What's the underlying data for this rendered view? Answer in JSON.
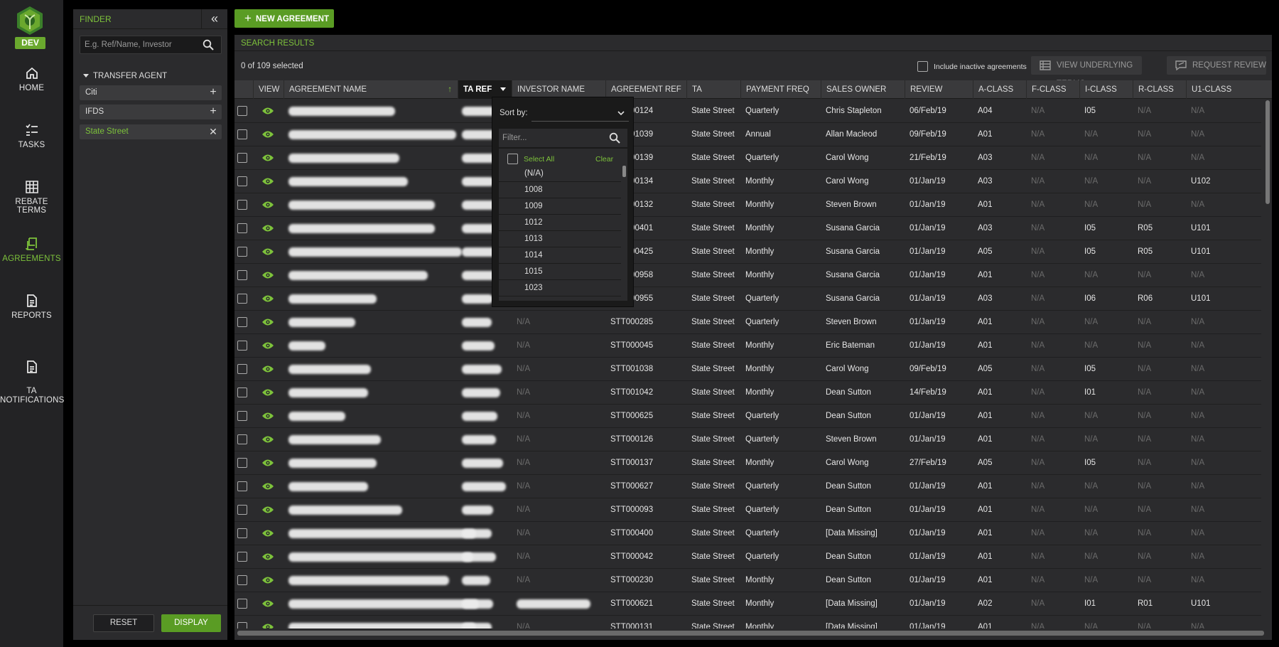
{
  "nav": {
    "env": "DEV",
    "items": [
      {
        "label": "HOME",
        "icon": "home-icon"
      },
      {
        "label": "TASKS",
        "icon": "tasks-icon"
      },
      {
        "label": "REBATE TERMS",
        "icon": "grid-icon"
      },
      {
        "label": "AGREEMENTS",
        "icon": "document-icon",
        "active": true
      },
      {
        "label": "REPORTS",
        "icon": "report-icon"
      },
      {
        "label": "TA\nNOTIFICATIONS",
        "icon": "notification-doc-icon"
      }
    ]
  },
  "finder": {
    "title": "FINDER",
    "collapse_icon": "«",
    "search_placeholder": "E.g. Ref/Name, Investor",
    "group_label": "TRANSFER AGENT",
    "filters": [
      {
        "label": "Citi",
        "selected": false
      },
      {
        "label": "IFDS",
        "selected": false
      },
      {
        "label": "State Street",
        "selected": true
      }
    ],
    "reset_label": "RESET",
    "display_label": "DISPLAY"
  },
  "new_agreement_label": "NEW AGREEMENT",
  "results": {
    "title": "SEARCH RESULTS",
    "selected_text": "0 of 109 selected",
    "include_inactive_label": "Include inactive agreements",
    "view_underlying_label": "VIEW UNDERLYING TERMS",
    "request_review_label": "REQUEST REVIEW",
    "columns": [
      "VIEW",
      "AGREEMENT NAME",
      "TA REF",
      "INVESTOR NAME",
      "AGREEMENT REF",
      "TA",
      "PAYMENT FREQ",
      "SALES OWNER",
      "REVIEW",
      "A-CLASS",
      "F-CLASS",
      "I-CLASS",
      "R-CLASS",
      "U1-CLASS"
    ],
    "rows": [
      {
        "investor": "",
        "ref": "STT000124",
        "ta": "State Street",
        "freq": "Quarterly",
        "owner": "Chris Stapleton",
        "review": "06/Feb/19",
        "a": "A04",
        "f": "N/A",
        "i": "I05",
        "r": "N/A",
        "u1": "N/A"
      },
      {
        "investor": "",
        "ref": "STT001039",
        "ta": "State Street",
        "freq": "Annual",
        "owner": "Allan Macleod",
        "review": "09/Feb/19",
        "a": "A01",
        "f": "N/A",
        "i": "N/A",
        "r": "N/A",
        "u1": "N/A"
      },
      {
        "investor": "",
        "ref": "STT000139",
        "ta": "State Street",
        "freq": "Quarterly",
        "owner": "Carol Wong",
        "review": "21/Feb/19",
        "a": "A03",
        "f": "N/A",
        "i": "N/A",
        "r": "N/A",
        "u1": "N/A"
      },
      {
        "investor": "",
        "ref": "STT000134",
        "ta": "State Street",
        "freq": "Monthly",
        "owner": "Carol Wong",
        "review": "01/Jan/19",
        "a": "A03",
        "f": "N/A",
        "i": "N/A",
        "r": "N/A",
        "u1": "U102"
      },
      {
        "investor": "",
        "ref": "STT000132",
        "ta": "State Street",
        "freq": "Monthly",
        "owner": "Steven Brown",
        "review": "01/Jan/19",
        "a": "A01",
        "f": "N/A",
        "i": "N/A",
        "r": "N/A",
        "u1": "N/A"
      },
      {
        "investor": "",
        "ref": "STT000401",
        "ta": "State Street",
        "freq": "Monthly",
        "owner": "Susana Garcia",
        "review": "01/Jan/19",
        "a": "A03",
        "f": "N/A",
        "i": "I05",
        "r": "R05",
        "u1": "U101"
      },
      {
        "investor": "",
        "ref": "STT000425",
        "ta": "State Street",
        "freq": "Monthly",
        "owner": "Susana Garcia",
        "review": "01/Jan/19",
        "a": "A05",
        "f": "N/A",
        "i": "I05",
        "r": "R05",
        "u1": "U101"
      },
      {
        "investor": "",
        "ref": "STT000958",
        "ta": "State Street",
        "freq": "Monthly",
        "owner": "Susana Garcia",
        "review": "01/Jan/19",
        "a": "A01",
        "f": "N/A",
        "i": "N/A",
        "r": "N/A",
        "u1": "N/A"
      },
      {
        "investor": "",
        "ref": "STT000955",
        "ta": "State Street",
        "freq": "Quarterly",
        "owner": "Susana Garcia",
        "review": "01/Jan/19",
        "a": "A03",
        "f": "N/A",
        "i": "I06",
        "r": "R06",
        "u1": "U101"
      },
      {
        "investor": "N/A",
        "ref": "STT000285",
        "ta": "State Street",
        "freq": "Quarterly",
        "owner": "Steven Brown",
        "review": "01/Jan/19",
        "a": "A01",
        "f": "N/A",
        "i": "N/A",
        "r": "N/A",
        "u1": "N/A"
      },
      {
        "investor": "N/A",
        "ref": "STT000045",
        "ta": "State Street",
        "freq": "Monthly",
        "owner": "Eric Bateman",
        "review": "01/Jan/19",
        "a": "A01",
        "f": "N/A",
        "i": "N/A",
        "r": "N/A",
        "u1": "N/A"
      },
      {
        "investor": "N/A",
        "ref": "STT001038",
        "ta": "State Street",
        "freq": "Monthly",
        "owner": "Carol Wong",
        "review": "09/Feb/19",
        "a": "A05",
        "f": "N/A",
        "i": "I05",
        "r": "N/A",
        "u1": "N/A"
      },
      {
        "investor": "N/A",
        "ref": "STT001042",
        "ta": "State Street",
        "freq": "Monthly",
        "owner": "Dean Sutton",
        "review": "14/Feb/19",
        "a": "A01",
        "f": "N/A",
        "i": "I01",
        "r": "N/A",
        "u1": "N/A"
      },
      {
        "investor": "N/A",
        "ref": "STT000625",
        "ta": "State Street",
        "freq": "Quarterly",
        "owner": "Dean Sutton",
        "review": "01/Jan/19",
        "a": "A01",
        "f": "N/A",
        "i": "N/A",
        "r": "N/A",
        "u1": "N/A"
      },
      {
        "investor": "N/A",
        "ref": "STT000126",
        "ta": "State Street",
        "freq": "Quarterly",
        "owner": "Steven Brown",
        "review": "01/Jan/19",
        "a": "A01",
        "f": "N/A",
        "i": "N/A",
        "r": "N/A",
        "u1": "N/A"
      },
      {
        "investor": "N/A",
        "ref": "STT000137",
        "ta": "State Street",
        "freq": "Monthly",
        "owner": "Carol Wong",
        "review": "27/Feb/19",
        "a": "A05",
        "f": "N/A",
        "i": "I05",
        "r": "N/A",
        "u1": "N/A"
      },
      {
        "investor": "N/A",
        "ref": "STT000627",
        "ta": "State Street",
        "freq": "Quarterly",
        "owner": "Dean Sutton",
        "review": "01/Jan/19",
        "a": "A01",
        "f": "N/A",
        "i": "N/A",
        "r": "N/A",
        "u1": "N/A"
      },
      {
        "investor": "N/A",
        "ref": "STT000093",
        "ta": "State Street",
        "freq": "Quarterly",
        "owner": "Dean Sutton",
        "review": "01/Jan/19",
        "a": "A01",
        "f": "N/A",
        "i": "N/A",
        "r": "N/A",
        "u1": "N/A"
      },
      {
        "investor": "N/A",
        "ref": "STT000400",
        "ta": "State Street",
        "freq": "Quarterly",
        "owner": "[Data Missing]",
        "review": "01/Jan/19",
        "a": "A01",
        "f": "N/A",
        "i": "N/A",
        "r": "N/A",
        "u1": "N/A"
      },
      {
        "investor": "N/A",
        "ref": "STT000042",
        "ta": "State Street",
        "freq": "Quarterly",
        "owner": "Dean Sutton",
        "review": "01/Jan/19",
        "a": "A01",
        "f": "N/A",
        "i": "N/A",
        "r": "N/A",
        "u1": "N/A"
      },
      {
        "investor": "N/A",
        "ref": "STT000230",
        "ta": "State Street",
        "freq": "Monthly",
        "owner": "Dean Sutton",
        "review": "01/Jan/19",
        "a": "A01",
        "f": "N/A",
        "i": "N/A",
        "r": "N/A",
        "u1": "N/A"
      },
      {
        "investor": "",
        "ref": "STT000621",
        "ta": "State Street",
        "freq": "Monthly",
        "owner": "[Data Missing]",
        "review": "01/Jan/19",
        "a": "A02",
        "f": "N/A",
        "i": "I01",
        "r": "R01",
        "u1": "U101"
      },
      {
        "investor": "N/A",
        "ref": "STT000131",
        "ta": "State Street",
        "freq": "Monthly",
        "owner": "[Data Missing]",
        "review": "01/Jan/19",
        "a": "A01",
        "f": "N/A",
        "i": "N/A",
        "r": "N/A",
        "u1": "N/A"
      }
    ]
  },
  "taref_menu": {
    "sort_label": "Sort by:",
    "filter_placeholder": "Filter...",
    "select_all_label": "Select All",
    "clear_label": "Clear",
    "options": [
      "(N/A)",
      "1008",
      "1009",
      "1012",
      "1013",
      "1014",
      "1015",
      "1023"
    ]
  },
  "colors": {
    "accent": "#7dc23b",
    "button_green": "#5a9c24",
    "panel": "#2b2b2d",
    "nav": "#232325"
  }
}
